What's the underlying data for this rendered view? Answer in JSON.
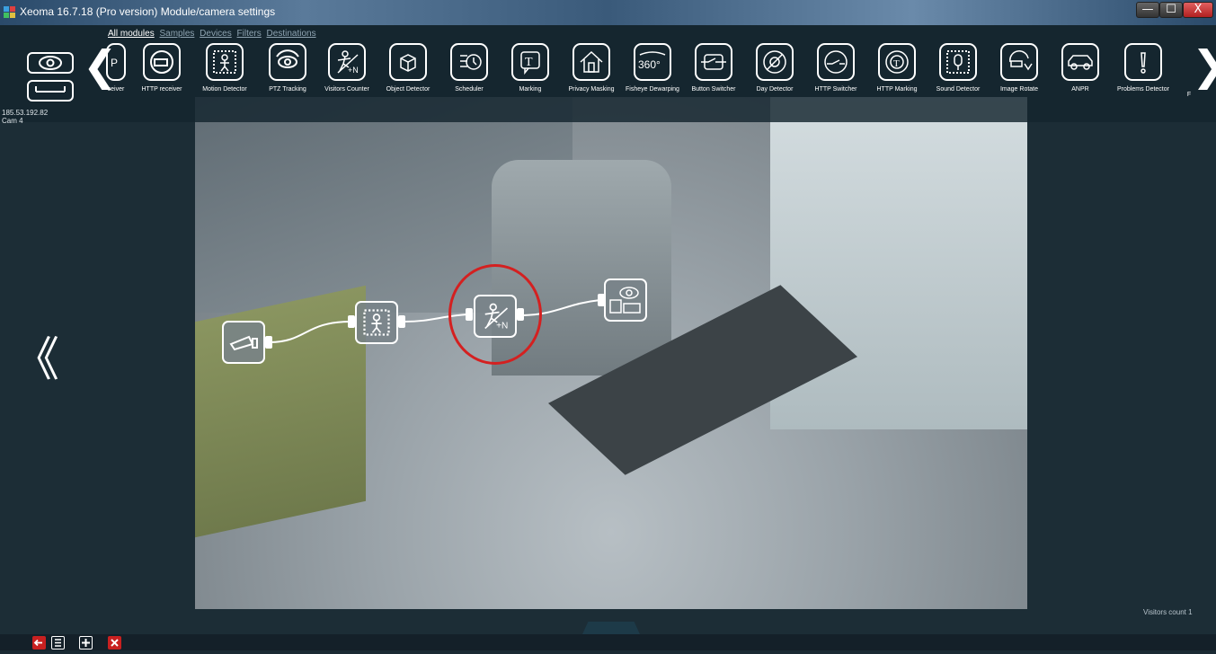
{
  "window": {
    "title": "Xeoma 16.7.18 (Pro version) Module/camera settings",
    "min_label": "—",
    "max_label": "☐",
    "close_label": "X"
  },
  "filter_tabs": [
    "All modules",
    "Samples",
    "Devices",
    "Filters",
    "Destinations"
  ],
  "modules": [
    {
      "label": "P\nver\nceiver",
      "icon": "http-receiver-partial-icon"
    },
    {
      "label": "HTTP receiver",
      "icon": "http-receiver-icon"
    },
    {
      "label": "Motion Detector",
      "icon": "motion-detector-icon"
    },
    {
      "label": "PTZ Tracking",
      "icon": "ptz-tracking-icon"
    },
    {
      "label": "Visitors Counter",
      "icon": "visitors-counter-icon"
    },
    {
      "label": "Object Detector",
      "icon": "object-detector-icon"
    },
    {
      "label": "Scheduler",
      "icon": "scheduler-icon"
    },
    {
      "label": "Marking",
      "icon": "marking-icon"
    },
    {
      "label": "Privacy Masking",
      "icon": "privacy-masking-icon"
    },
    {
      "label": "Fisheye Dewarping",
      "icon": "fisheye-dewarping-icon"
    },
    {
      "label": "Button Switcher",
      "icon": "button-switcher-icon"
    },
    {
      "label": "Day Detector",
      "icon": "day-detector-icon"
    },
    {
      "label": "HTTP Switcher",
      "icon": "http-switcher-icon"
    },
    {
      "label": "HTTP Marking",
      "icon": "http-marking-icon"
    },
    {
      "label": "Sound Detector",
      "icon": "sound-detector-icon"
    },
    {
      "label": "Image Rotate",
      "icon": "image-rotate-icon"
    },
    {
      "label": "ANPR",
      "icon": "anpr-icon"
    },
    {
      "label": "Problems Detector",
      "icon": "problems-detector-icon"
    },
    {
      "label": "F",
      "icon": "partial-module-icon"
    }
  ],
  "camera": {
    "ip": "185.53.192.82",
    "name": "Cam  4"
  },
  "chain": [
    "camera-source-node",
    "motion-detector-node",
    "visitors-counter-node",
    "preview-archive-node"
  ],
  "status": {
    "visitors_count": "Visitors count 1"
  },
  "colors": {
    "highlight": "#d42020",
    "bar_bg": "#14242e",
    "accent_red": "#d42020"
  }
}
